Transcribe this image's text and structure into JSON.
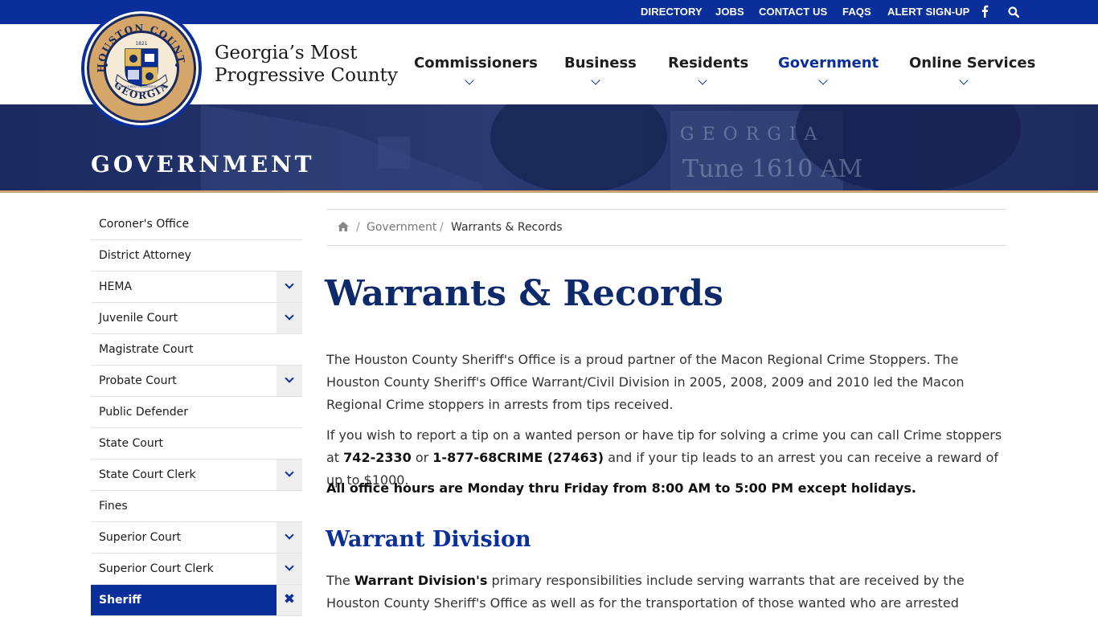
{
  "topbar": {
    "links": [
      "DIRECTORY",
      "JOBS",
      "CONTACT US",
      "FAQS",
      "ALERT SIGN-UP"
    ],
    "icons": [
      "facebook-icon",
      "search-icon"
    ]
  },
  "seal": {
    "top_text": "HOUSTON COUNTY",
    "bottom_text": "GEORGIA",
    "year": "1821",
    "ribbon": "GEORGIA'S MOST PROGRESSIVE COUNTY"
  },
  "header": {
    "tagline_line1": "Georgia’s Most",
    "tagline_line2": "Progressive County",
    "nav": [
      {
        "label": "Commissioners",
        "active": false
      },
      {
        "label": "Business",
        "active": false
      },
      {
        "label": "Residents",
        "active": false
      },
      {
        "label": "Government",
        "active": true
      },
      {
        "label": "Online Services",
        "active": false
      }
    ]
  },
  "hero": {
    "title": "GOVERNMENT",
    "sign_line1": "GEORGIA",
    "sign_line2": "Tune 1610 AM"
  },
  "sidebar": {
    "items": [
      {
        "label": "Coroner's Office",
        "expandable": false
      },
      {
        "label": "District Attorney",
        "expandable": false
      },
      {
        "label": "HEMA",
        "expandable": true
      },
      {
        "label": "Juvenile Court",
        "expandable": true
      },
      {
        "label": "Magistrate Court",
        "expandable": false
      },
      {
        "label": "Probate Court",
        "expandable": true
      },
      {
        "label": "Public Defender",
        "expandable": false
      },
      {
        "label": "State Court",
        "expandable": false
      },
      {
        "label": "State Court Clerk",
        "expandable": true
      },
      {
        "label": "Fines",
        "expandable": false
      },
      {
        "label": "Superior Court",
        "expandable": true
      },
      {
        "label": "Superior Court Clerk",
        "expandable": true
      },
      {
        "label": "Sheriff",
        "expandable": true,
        "active": true
      }
    ]
  },
  "breadcrumb": {
    "sep": "/",
    "items": [
      "Government",
      "Warrants & Records"
    ]
  },
  "content": {
    "title": "Warrants & Records",
    "para1": "The Houston County Sheriff's Office is a proud partner of the Macon Regional Crime Stoppers. The Houston County Sheriff's Office Warrant/Civil Division in 2005, 2008, 2009 and 2010 led the Macon Regional Crime stoppers in arrests from tips received.",
    "para2_a": "If you wish to report a tip on a wanted person or have tip for solving a crime you can call Crime stoppers at ",
    "para2_b": "742-2330",
    "para2_c": " or ",
    "para2_d": "1-877-68CRIME (27463)",
    "para2_e": " and if your tip leads to an arrest you can receive a reward of up to $1000.",
    "para3": "All office hours are Monday thru Friday from 8:00 AM to 5:00 PM except holidays.",
    "section_title": "Warrant Division",
    "para4_a": "The ",
    "para4_b": "Warrant Division's",
    "para4_c": " primary responsibilities include serving warrants that are received by the Houston County Sheriff's Office as well as for the transportation of those wanted who are arrested outside of Houston"
  },
  "colors": {
    "brand_blue": "#0a2f9a",
    "hero_navy": "#1c2b5e",
    "accent_gold": "#c9a471",
    "title_navy": "#0e2a6b"
  }
}
